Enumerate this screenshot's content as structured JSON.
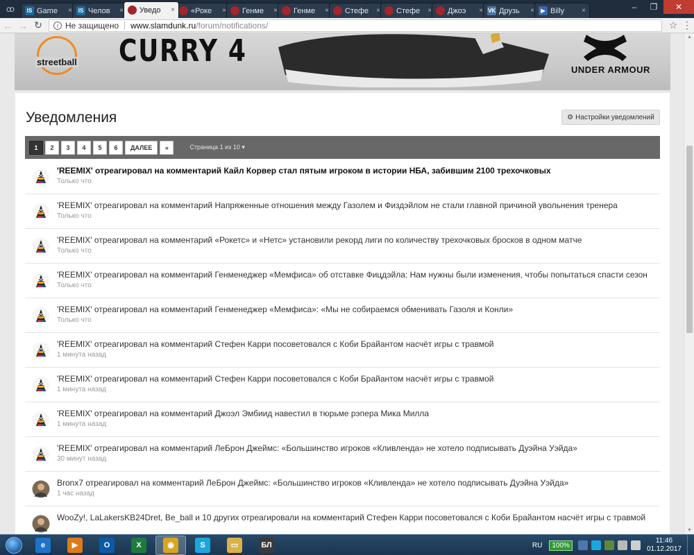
{
  "browser": {
    "tabs": [
      {
        "title": "Game",
        "favicon": "is"
      },
      {
        "title": "Челов",
        "favicon": "is"
      },
      {
        "title": "Уведо",
        "favicon": "ball",
        "active": true
      },
      {
        "title": "«Роке",
        "favicon": "ball"
      },
      {
        "title": "Генме",
        "favicon": "ball"
      },
      {
        "title": "Генме",
        "favicon": "ball"
      },
      {
        "title": "Стефе",
        "favicon": "ball"
      },
      {
        "title": "Стефе",
        "favicon": "ball"
      },
      {
        "title": "Джоэ",
        "favicon": "ball"
      },
      {
        "title": "Друзь",
        "favicon": "vk"
      },
      {
        "title": "Billy",
        "favicon": "play"
      }
    ],
    "security_label": "Не защищено",
    "url_host": "www.slamdunk.ru",
    "url_path": "/forum/notifications/"
  },
  "banner": {
    "left_logo": "streetball",
    "headline": "CURRY 4",
    "brand": "UNDER ARMOUR"
  },
  "page": {
    "title": "Уведомления",
    "settings_button": "Настройки уведомлений",
    "pagination": {
      "pages": [
        "1",
        "2",
        "3",
        "4",
        "5",
        "6"
      ],
      "current": "1",
      "next_label": "ДАЛЕЕ",
      "last_label": "»",
      "page_info": "Страница 1 из 10"
    },
    "notifications": [
      {
        "text": "'REEMIX' отреагировал на комментарий Кайл Корвер стал пятым игроком в истории НБА, забившим 2100 трехочковых",
        "time": "Только что",
        "unread": true,
        "avatar": "duck"
      },
      {
        "text": "'REEMIX' отреагировал на комментарий Напряженные отношения между Газолем и Физдэйлом не стали главной причиной увольнения тренера",
        "time": "Только что",
        "avatar": "duck"
      },
      {
        "text": "'REEMIX' отреагировал на комментарий «Рокетс» и «Нетс» установили рекорд лиги по количеству трехочковых бросков в одном матче",
        "time": "Только что",
        "avatar": "duck"
      },
      {
        "text": "'REEMIX' отреагировал на комментарий Генменеджер «Мемфиса» об отставке Фицдэйла: Нам нужны были изменения, чтобы попытаться спасти сезон",
        "time": "Только что",
        "avatar": "duck"
      },
      {
        "text": "'REEMIX' отреагировал на комментарий Генменеджер «Мемфиса»: «Мы не собираемся обменивать Газоля и Конли»",
        "time": "Только что",
        "avatar": "duck"
      },
      {
        "text": "'REEMIX' отреагировал на комментарий Стефен Карри посоветовался с Коби Брайантом насчёт игры с травмой",
        "time": "1 минута назад",
        "avatar": "duck"
      },
      {
        "text": "'REEMIX' отреагировал на комментарий Стефен Карри посоветовался с Коби Брайантом насчёт игры с травмой",
        "time": "1 минута назад",
        "avatar": "duck"
      },
      {
        "text": "'REEMIX' отреагировал на комментарий Джоэл Эмбиид навестил в тюрьме рэпера Мика Милла",
        "time": "1 минута назад",
        "avatar": "duck"
      },
      {
        "text": "'REEMIX' отреагировал на комментарий ЛеБрон Джеймс: «Большинство игроков «Кливленда» не хотело подписывать Дуэйна Уэйда»",
        "time": "30 минут назад",
        "avatar": "duck"
      },
      {
        "text": "Bronx7 отреагировал на комментарий ЛеБрон Джеймс: «Большинство игроков «Кливленда» не хотело подписывать Дуэйна Уэйда»",
        "time": "1 час назад",
        "avatar": "photo"
      },
      {
        "text": "WooZy!, LaLakersKB24Dret, Be_ball и 10 других отреагировали на комментарий Стефен Карри посоветовался с Коби Брайантом насчёт игры с травмой",
        "time": "",
        "avatar": "photo"
      }
    ]
  },
  "taskbar": {
    "apps": [
      {
        "name": "internet-explorer",
        "color": "#1e73c9",
        "glyph": "e"
      },
      {
        "name": "media-player",
        "color": "#e07a18",
        "glyph": "▶"
      },
      {
        "name": "outlook",
        "color": "#0a5aa8",
        "glyph": "O"
      },
      {
        "name": "excel",
        "color": "#1d7a3d",
        "glyph": "X"
      },
      {
        "name": "chrome",
        "color": "#d9a420",
        "glyph": "◉",
        "active": true
      },
      {
        "name": "skype",
        "color": "#1aa7e0",
        "glyph": "S"
      },
      {
        "name": "file-explorer",
        "color": "#d9b24a",
        "glyph": "▭"
      },
      {
        "name": "app-bl",
        "color": "#3a3a3a",
        "glyph": "БЛ"
      }
    ],
    "language": "RU",
    "battery": "100%",
    "time": "11:46",
    "date": "01.12.2017"
  },
  "colors": {
    "accent": "#686868",
    "unread_text": "#111111",
    "timestamp": "#999999"
  }
}
